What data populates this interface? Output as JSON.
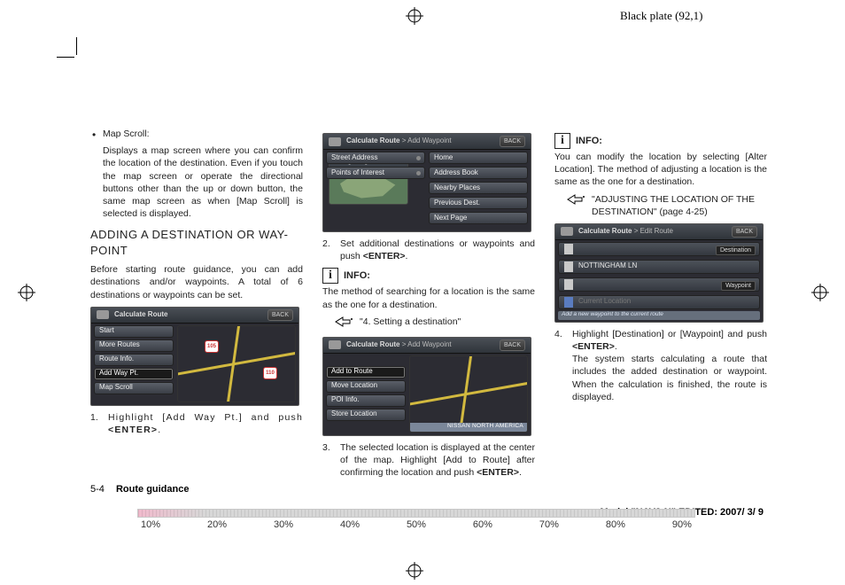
{
  "header": {
    "plate": "Black plate (92,1)"
  },
  "col1": {
    "bullet_title": "Map Scroll:",
    "bullet_body": "Displays a map screen where you can confirm the location of the destination. Even if you touch the map screen or operate the directional buttons other than the up or down button, the same map screen as when [Map Scroll] is selected is displayed.",
    "heading": "ADDING A DESTINATION OR WAY-POINT",
    "intro": "Before starting route guidance, you can add destinations and/or waypoints. A total of 6 destinations or waypoints can be set.",
    "shot1": {
      "breadcrumb": "Calculate Route",
      "back": "BACK",
      "buttons": [
        "Start",
        "More Routes",
        "Route Info.",
        "Add Way Pt.",
        "Map Scroll"
      ],
      "selected_index": 3,
      "shields": [
        "105",
        "110"
      ]
    },
    "step1_num": "1.",
    "step1_text_a": "Highlight [Add Way Pt.] and push ",
    "step1_enter": "<ENTER>",
    "step1_tail": "."
  },
  "col2": {
    "shot2": {
      "breadcrumb_a": "Calculate Route",
      "breadcrumb_b": " > Add Waypoint",
      "back": "BACK",
      "map_label": "Change Region",
      "left": [
        "Street Address",
        "Points of Interest"
      ],
      "right": [
        "Home",
        "Address Book",
        "Nearby Places",
        "Previous Dest.",
        "Next Page"
      ]
    },
    "step2_num": "2.",
    "step2_text": "Set additional destinations or waypoints and push ",
    "step2_enter": "<ENTER>",
    "step2_tail": ".",
    "info_label": "INFO:",
    "info_body": "The method of searching for a location is the same as the one for a destination.",
    "ref_text": "\"4. Setting a destination\"",
    "shot3": {
      "breadcrumb_a": "Calculate Route",
      "breadcrumb_b": " > Add Waypoint",
      "back": "BACK",
      "buttons": [
        "Add to Route",
        "Move Location",
        "POI Info.",
        "Store Location"
      ],
      "banner": "NISSAN NORTH AMERICA"
    },
    "step3_num": "3.",
    "step3_text": "The selected location is displayed at the center of the map. Highlight [Add to Route] after confirming the location and push ",
    "step3_enter": "<ENTER>",
    "step3_tail": "."
  },
  "col3": {
    "info_label": "INFO:",
    "info_body": "You can modify the location by selecting [Alter Location]. The method of adjusting a location is the same as the one for a destination.",
    "ref_text": "\"ADJUSTING THE LOCATION OF THE DESTINATION\" (page 4-25)",
    "shot4": {
      "breadcrumb_a": "Calculate Route",
      "breadcrumb_b": " > Edit Route",
      "back": "BACK",
      "rows": [
        {
          "label": "",
          "tag": "Destination",
          "plus": true
        },
        {
          "label": "NOTTINGHAM LN",
          "tag": "",
          "plus": false
        },
        {
          "label": "",
          "tag": "Waypoint",
          "plus": true
        },
        {
          "label": "Current Location",
          "tag": "",
          "plus": false,
          "dim": true
        }
      ],
      "footer": "Add a new waypoint to the current route"
    },
    "step4_num": "4.",
    "step4_text": "Highlight [Destination] or [Waypoint] and push ",
    "step4_enter": "<ENTER>",
    "step4_tail": ".",
    "result": "The system starts calculating a route that includes the added destination or waypoint. When the calculation is finished, the route is displayed."
  },
  "footer": {
    "page": "5-4",
    "section": "Route guidance",
    "model_a": "Model \"",
    "model_b": "NAV2-N",
    "model_c": "\" EDITED: 2007/ 3/ 9"
  },
  "percent": [
    "10%",
    "20%",
    "30%",
    "40%",
    "50%",
    "60%",
    "70%",
    "80%",
    "90%"
  ]
}
